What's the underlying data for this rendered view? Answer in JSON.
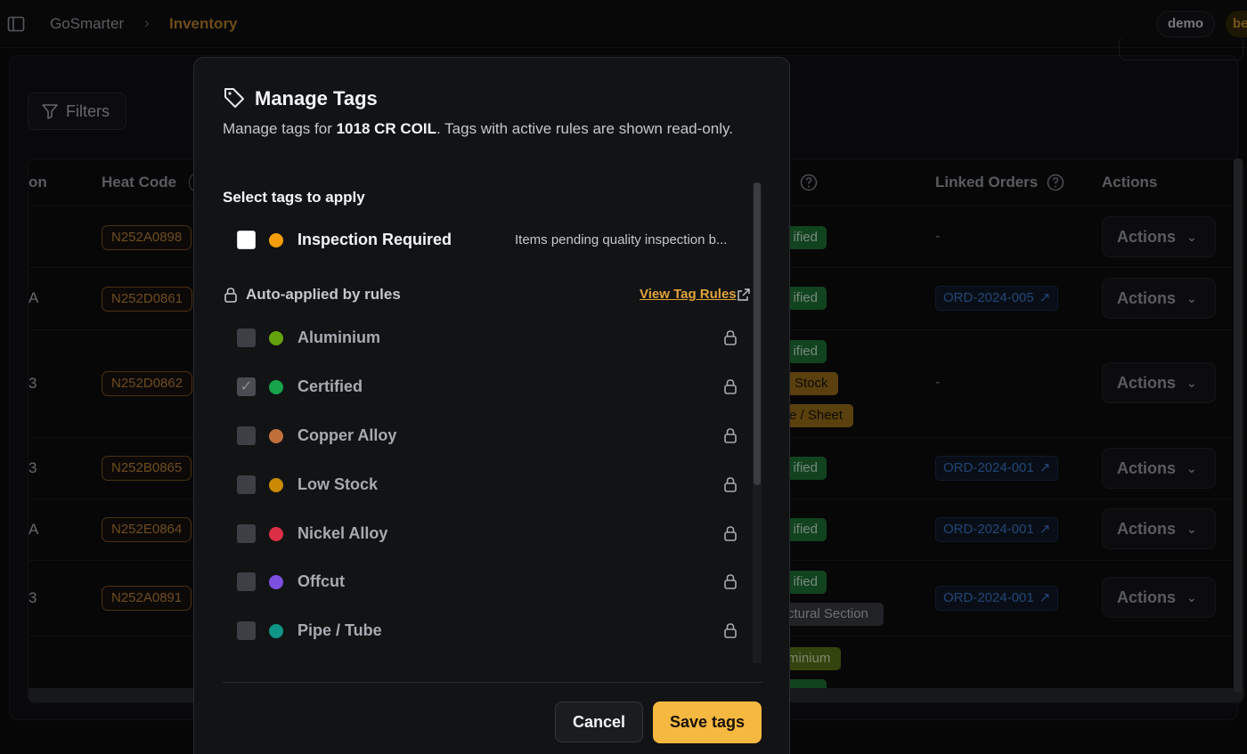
{
  "breadcrumb": {
    "root": "GoSmarter",
    "separator": "›",
    "current": "Inventory"
  },
  "header": {
    "user": "demo",
    "env": "be"
  },
  "filters": {
    "label": "Filters"
  },
  "table": {
    "headers": {
      "location_partial": "on",
      "heat_code": "Heat Code",
      "linked_orders": "Linked Orders",
      "actions": "Actions"
    },
    "rows": [
      {
        "loc": "",
        "heat": "N252A0898",
        "tags": [
          "ified"
        ],
        "order": "-",
        "action": "Actions"
      },
      {
        "loc": "A",
        "heat": "N252D0861",
        "tags": [
          "ified"
        ],
        "order": "ORD-2024-005",
        "action": "Actions"
      },
      {
        "loc": "3",
        "heat": "N252D0862",
        "tags": [
          "ified",
          "Stock",
          "e / Sheet"
        ],
        "order": "-",
        "action": "Actions"
      },
      {
        "loc": "3",
        "heat": "N252B0865",
        "tags": [
          "ified"
        ],
        "order": "ORD-2024-001",
        "action": "Actions"
      },
      {
        "loc": "A",
        "heat": "N252E0864",
        "tags": [
          "ified"
        ],
        "order": "ORD-2024-001",
        "action": "Actions"
      },
      {
        "loc": "3",
        "heat": "N252A0891",
        "tags": [
          "ified",
          "ctural Section"
        ],
        "order": "ORD-2024-001",
        "action": "Actions"
      },
      {
        "loc": "",
        "heat": "",
        "tags": [
          "minium"
        ],
        "order": "",
        "action": ""
      }
    ]
  },
  "modal": {
    "title": "Manage Tags",
    "desc_pre": "Manage tags for ",
    "desc_item": "1018 CR COIL",
    "desc_post": ". Tags with active rules are shown read-only.",
    "select_title": "Select tags to apply",
    "active_tags": [
      {
        "label": "Inspection Required",
        "color": "#f59e0b",
        "description": "Items pending quality inspection b..."
      }
    ],
    "auto_title": "Auto-applied by rules",
    "view_rules": "View Tag Rules",
    "locked_tags": [
      {
        "label": "Aluminium",
        "color": "#65a30d",
        "checked": false
      },
      {
        "label": "Certified",
        "color": "#16a34a",
        "checked": true
      },
      {
        "label": "Copper Alloy",
        "color": "#c2703b",
        "checked": false
      },
      {
        "label": "Low Stock",
        "color": "#ca8a04",
        "checked": false
      },
      {
        "label": "Nickel Alloy",
        "color": "#dc2f45",
        "checked": false
      },
      {
        "label": "Offcut",
        "color": "#7c4fe0",
        "checked": false
      },
      {
        "label": "Pipe / Tube",
        "color": "#0f9488",
        "checked": false
      }
    ],
    "cancel": "Cancel",
    "save": "Save tags"
  }
}
